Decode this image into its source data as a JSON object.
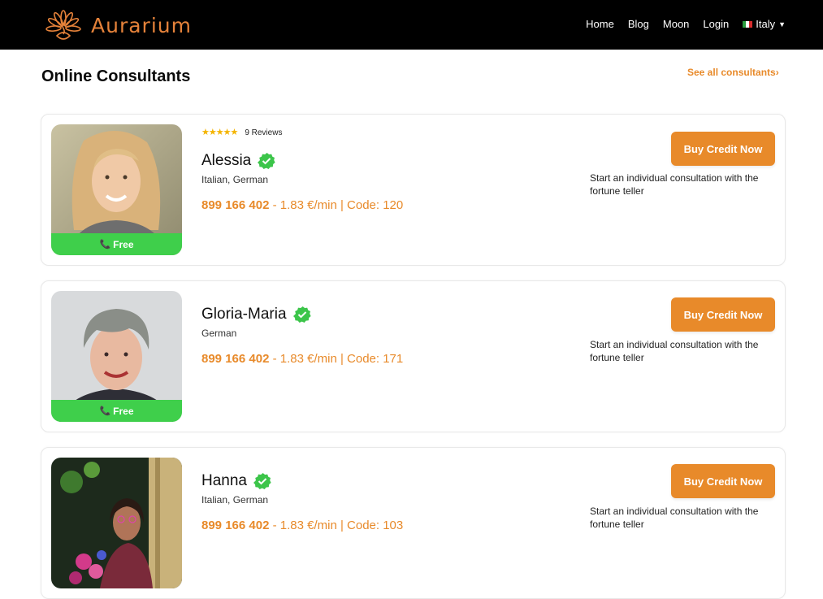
{
  "header": {
    "brand": "Aurarium",
    "nav": [
      "Home",
      "Blog",
      "Moon",
      "Login"
    ],
    "language": "Italy"
  },
  "main": {
    "title": "Online Consultants",
    "see_all": "See all consultants›"
  },
  "colors": {
    "accent": "#e88a2a",
    "free_green": "#3fcf4b",
    "verified_green": "#3cc54a",
    "topbar": "#000000"
  },
  "consultants": [
    {
      "name": "Alessia",
      "languages": "Italian, German",
      "rating": 5,
      "reviews": "9 Reviews",
      "phone": "899 166 402",
      "rate_code": " - 1.83 €/min | Code: 120",
      "badge": "Free",
      "buy_label": "Buy Credit Now",
      "description": "Start an individual consultation with the fortune teller"
    },
    {
      "name": "Gloria-Maria",
      "languages": "German",
      "phone": "899 166 402",
      "rate_code": " - 1.83 €/min | Code: 171",
      "badge": "Free",
      "buy_label": "Buy Credit Now",
      "description": "Start an individual consultation with the fortune teller"
    },
    {
      "name": "Hanna",
      "languages": "Italian, German",
      "phone": "899 166 402",
      "rate_code": " - 1.83 €/min | Code: 103",
      "buy_label": "Buy Credit Now",
      "description": "Start an individual consultation with the fortune teller"
    }
  ]
}
